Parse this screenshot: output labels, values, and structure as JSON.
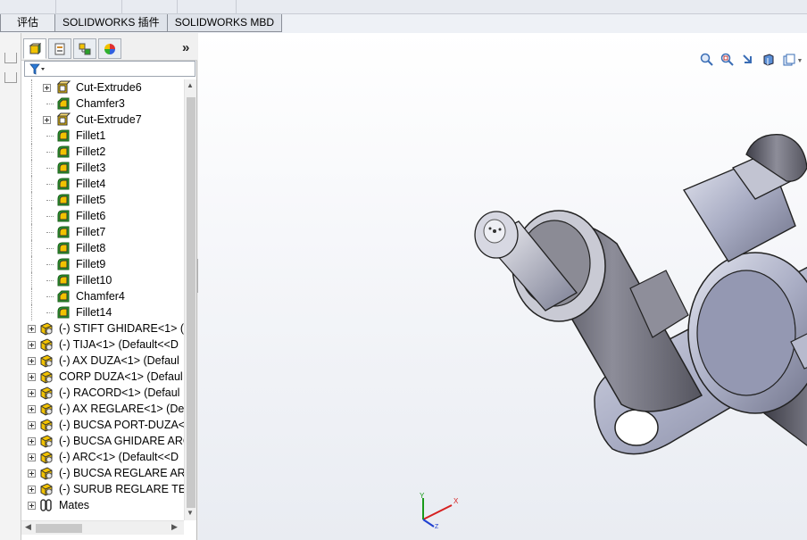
{
  "tabs": [
    {
      "label": "评估",
      "active": false
    },
    {
      "label": "SOLIDWORKS 插件",
      "active": false
    },
    {
      "label": "SOLIDWORKS MBD",
      "active": false
    }
  ],
  "feature_manager": {
    "panel_tabs": [
      {
        "icon": "feature-tree-icon"
      },
      {
        "icon": "property-manager-icon"
      },
      {
        "icon": "configuration-manager-icon"
      },
      {
        "icon": "display-manager-icon"
      }
    ],
    "more_label": "»",
    "filter_icon": "filter-icon",
    "tree": [
      {
        "label": "Cut-Extrude6",
        "icon": "cut-extrude-icon",
        "indent": 2,
        "expandable": true
      },
      {
        "label": "Chamfer3",
        "icon": "chamfer-icon",
        "indent": 2,
        "expandable": false
      },
      {
        "label": "Cut-Extrude7",
        "icon": "cut-extrude-icon",
        "indent": 2,
        "expandable": true
      },
      {
        "label": "Fillet1",
        "icon": "fillet-icon",
        "indent": 2,
        "expandable": false
      },
      {
        "label": "Fillet2",
        "icon": "fillet-icon",
        "indent": 2,
        "expandable": false
      },
      {
        "label": "Fillet3",
        "icon": "fillet-icon",
        "indent": 2,
        "expandable": false
      },
      {
        "label": "Fillet4",
        "icon": "fillet-icon",
        "indent": 2,
        "expandable": false
      },
      {
        "label": "Fillet5",
        "icon": "fillet-icon",
        "indent": 2,
        "expandable": false
      },
      {
        "label": "Fillet6",
        "icon": "fillet-icon",
        "indent": 2,
        "expandable": false
      },
      {
        "label": "Fillet7",
        "icon": "fillet-icon",
        "indent": 2,
        "expandable": false
      },
      {
        "label": "Fillet8",
        "icon": "fillet-icon",
        "indent": 2,
        "expandable": false
      },
      {
        "label": "Fillet9",
        "icon": "fillet-icon",
        "indent": 2,
        "expandable": false
      },
      {
        "label": "Fillet10",
        "icon": "fillet-icon",
        "indent": 2,
        "expandable": false
      },
      {
        "label": "Chamfer4",
        "icon": "chamfer-icon",
        "indent": 2,
        "expandable": false
      },
      {
        "label": "Fillet14",
        "icon": "fillet-icon",
        "indent": 2,
        "expandable": false
      },
      {
        "label": "(-) STIFT GHIDARE<1> (",
        "icon": "part-icon",
        "indent": 0,
        "expandable": true
      },
      {
        "label": "(-) TIJA<1> (Default<<D",
        "icon": "part-icon",
        "indent": 0,
        "expandable": true
      },
      {
        "label": "(-) AX DUZA<1> (Defaul",
        "icon": "part-icon",
        "indent": 0,
        "expandable": true
      },
      {
        "label": "CORP DUZA<1> (Defaul",
        "icon": "part-icon",
        "indent": 0,
        "expandable": true
      },
      {
        "label": "(-) RACORD<1> (Defaul",
        "icon": "part-icon",
        "indent": 0,
        "expandable": true
      },
      {
        "label": "(-) AX REGLARE<1> (De",
        "icon": "part-icon",
        "indent": 0,
        "expandable": true
      },
      {
        "label": "(-) BUCSA PORT-DUZA<",
        "icon": "part-icon",
        "indent": 0,
        "expandable": true
      },
      {
        "label": "(-) BUCSA GHIDARE ARC",
        "icon": "part-icon",
        "indent": 0,
        "expandable": true
      },
      {
        "label": "(-) ARC<1> (Default<<D",
        "icon": "part-icon",
        "indent": 0,
        "expandable": true
      },
      {
        "label": "(-) BUCSA REGLARE ARC",
        "icon": "part-icon",
        "indent": 0,
        "expandable": true
      },
      {
        "label": "(-) SURUB REGLARE TEN",
        "icon": "part-icon",
        "indent": 0,
        "expandable": true
      },
      {
        "label": "Mates",
        "icon": "mates-icon",
        "indent": 0,
        "expandable": true
      }
    ]
  },
  "heads_up_toolbar": [
    {
      "icon": "zoom-to-fit-icon",
      "dropdown": false
    },
    {
      "icon": "zoom-to-area-icon",
      "dropdown": false
    },
    {
      "icon": "previous-view-icon",
      "dropdown": false
    },
    {
      "icon": "section-view-icon",
      "dropdown": false
    },
    {
      "icon": "dynamic-annotation-icon",
      "dropdown": true
    },
    {
      "icon": "view-orientation-icon",
      "dropdown": true
    },
    {
      "icon": "display-style-icon",
      "dropdown": true
    },
    {
      "icon": "hide-show-items-icon",
      "dropdown": true
    },
    {
      "icon": "edit-appearance-icon",
      "dropdown": false
    },
    {
      "icon": "apply-scene-icon",
      "dropdown": true
    },
    {
      "icon": "view-settings-icon",
      "dropdown": true
    }
  ],
  "triad": {
    "x_label": "X",
    "y_label": "Y",
    "z_label": "Z"
  },
  "colors": {
    "tree_icon_green": "#2aa02a",
    "tree_icon_yellow": "#f2c200",
    "model_steel": "#a8acc2",
    "model_dark": "#5d5e6b"
  }
}
